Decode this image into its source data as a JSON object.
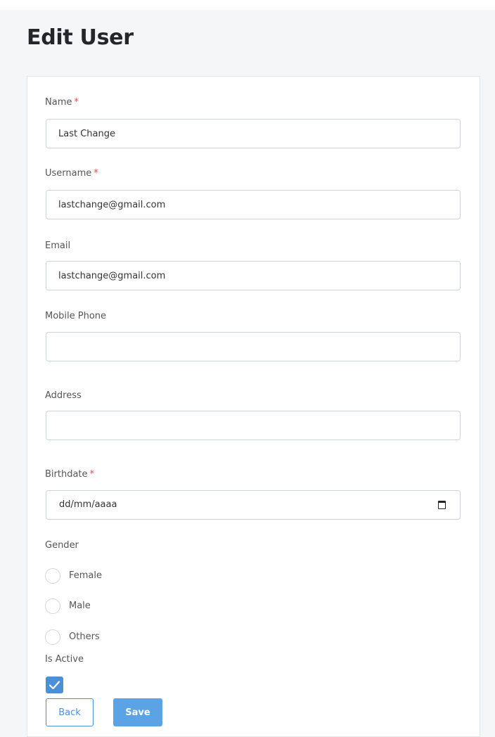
{
  "page": {
    "title": "Edit User"
  },
  "form": {
    "required_marker": "*",
    "name": {
      "label": "Name",
      "value": "Last Change"
    },
    "username": {
      "label": "Username",
      "value": "lastchange@gmail.com"
    },
    "email": {
      "label": "Email",
      "value": "lastchange@gmail.com"
    },
    "mobile_phone": {
      "label": "Mobile Phone",
      "value": ""
    },
    "address": {
      "label": "Address",
      "value": ""
    },
    "birthdate": {
      "label": "Birthdate",
      "placeholder": "dd/mm/aaaa",
      "icon": "calendar-icon"
    },
    "gender": {
      "label": "Gender",
      "options": [
        {
          "label": "Female",
          "checked": false
        },
        {
          "label": "Male",
          "checked": false
        },
        {
          "label": "Others",
          "checked": false
        }
      ]
    },
    "is_active": {
      "label": "Is Active",
      "checked": true,
      "icon": "checkmark-icon"
    }
  },
  "actions": {
    "back_label": "Back",
    "save_label": "Save"
  },
  "colors": {
    "accent": "#4a90d9",
    "save_button": "#5ca3e6",
    "required": "#d9534f",
    "border": "#cfd4da",
    "background": "#f4f6f8"
  }
}
